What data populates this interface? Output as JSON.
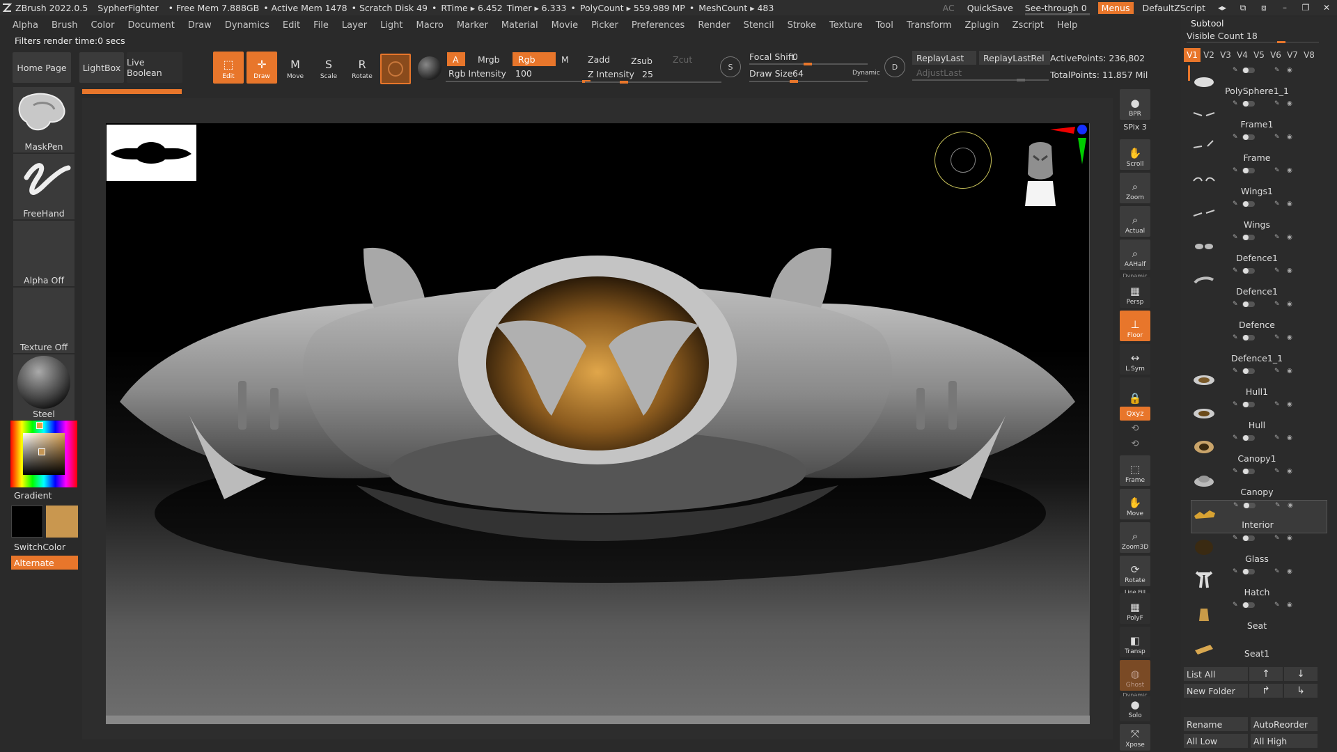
{
  "titlebar": {
    "app": "ZBrush 2022.0.5",
    "project": "SypherFighter",
    "stats": [
      "• Free Mem 7.888GB",
      "• Active Mem 1478",
      "• Scratch Disk 49",
      "•",
      "RTime ▸ 6.452",
      "Timer ▸ 6.333",
      "•",
      "PolyCount ▸ 559.989 MP",
      "•",
      "MeshCount ▸ 483"
    ],
    "ac": "AC",
    "quicksave": "QuickSave",
    "see_through": "See-through",
    "see_through_value": "0",
    "see_through_fraction": 0,
    "menus": "Menus",
    "default_zscript": "DefaultZScript"
  },
  "menubar": [
    "Alpha",
    "Brush",
    "Color",
    "Document",
    "Draw",
    "Dynamics",
    "Edit",
    "File",
    "Layer",
    "Light",
    "Macro",
    "Marker",
    "Material",
    "Movie",
    "Picker",
    "Preferences",
    "Render",
    "Stencil",
    "Stroke",
    "Texture",
    "Tool",
    "Transform",
    "Zplugin",
    "Zscript",
    "Help"
  ],
  "notice": "Filters render time:0 secs",
  "shelf": {
    "home_page": "Home Page",
    "lightbox": "LightBox",
    "live_boolean": "Live Boolean",
    "tools": {
      "edit": "Edit",
      "draw": "Draw",
      "move": "Move",
      "scale": "Scale",
      "rotate": "Rotate"
    },
    "a": "A",
    "mrgb": "Mrgb",
    "rgb": "Rgb",
    "m": "M",
    "zadd": "Zadd",
    "zsub": "Zsub",
    "zcut": "Zcut",
    "rgb_intensity_label": "Rgb Intensity",
    "rgb_intensity": "100",
    "z_intensity_label": "Z Intensity",
    "z_intensity": "25",
    "focal_shift_label": "Focal Shift",
    "focal_shift": "0",
    "draw_size_label": "Draw Size",
    "draw_size": "64",
    "dynamic": "Dynamic",
    "s": "S",
    "d": "D",
    "replay_last": "ReplayLast",
    "replay_last_rel": "ReplayLastRel",
    "adjust_last": "AdjustLast",
    "active_points": "ActivePoints: 236,802",
    "total_points": "TotalPoints: 11.857 Mil"
  },
  "left_panel": {
    "brush1": "MaskPen",
    "brush2": "FreeHand",
    "alpha": "Alpha Off",
    "texture": "Texture Off",
    "material": "Steel",
    "gradient": "Gradient",
    "switch_color": "SwitchColor",
    "alternate": "Alternate",
    "colors": {
      "main": "#000000",
      "secondary": "#c9974f",
      "accent": "#e8762b"
    }
  },
  "right_bar": {
    "bpr": "BPR",
    "spix_label": "SPix",
    "spix": "3",
    "scroll": "Scroll",
    "zoom": "Zoom",
    "actual": "Actual",
    "aahalf": "AAHalf",
    "dynamic": "Dynamic",
    "persp": "Persp",
    "floor": "Floor",
    "lsym": "L.Sym",
    "xyz": "Qxyz",
    "frame": "Frame",
    "move": "Move",
    "zoom3d": "Zoom3D",
    "rotate": "Rotate",
    "line_fill": "Line Fill",
    "polyf": "PolyF",
    "transp": "Transp",
    "ghost": "Ghost",
    "dynamic2": "Dynamic",
    "solo": "Solo",
    "xpose": "Xpose"
  },
  "subtool": {
    "title": "Subtool",
    "visible_count_label": "Visible Count",
    "visible_count": "18",
    "tabs": [
      "V1",
      "V2",
      "V3",
      "V4",
      "V5",
      "V6",
      "V7",
      "V8"
    ],
    "items": [
      {
        "name": "PolySphere1_1"
      },
      {
        "name": "Frame1"
      },
      {
        "name": "Frame"
      },
      {
        "name": "Wings1"
      },
      {
        "name": "Wings"
      },
      {
        "name": "Defence1"
      },
      {
        "name": "Defence1"
      },
      {
        "name": "Defence"
      },
      {
        "name": "Defence1_1"
      },
      {
        "name": "Hull1"
      },
      {
        "name": "Hull"
      },
      {
        "name": "Canopy1"
      },
      {
        "name": "Canopy"
      },
      {
        "name": "Interior"
      },
      {
        "name": "Glass"
      },
      {
        "name": "Hatch"
      },
      {
        "name": "Seat"
      },
      {
        "name": "Seat1"
      }
    ],
    "list_all": "List All",
    "new_folder": "New Folder",
    "rename": "Rename",
    "auto_reorder": "AutoReorder",
    "all_low": "All Low",
    "all_high": "All High"
  }
}
